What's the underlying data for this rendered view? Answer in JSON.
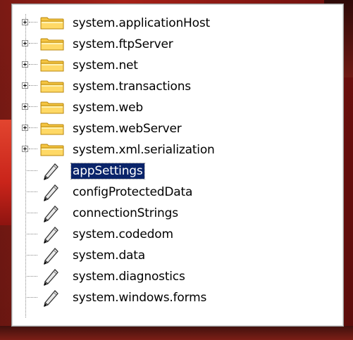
{
  "tree": {
    "folders": [
      {
        "label": "system.applicationHost",
        "icon": "folder-icon",
        "expander": "+"
      },
      {
        "label": "system.ftpServer",
        "icon": "folder-icon",
        "expander": "+"
      },
      {
        "label": "system.net",
        "icon": "folder-icon",
        "expander": "+"
      },
      {
        "label": "system.transactions",
        "icon": "folder-icon",
        "expander": "+"
      },
      {
        "label": "system.web",
        "icon": "folder-icon",
        "expander": "+"
      },
      {
        "label": "system.webServer",
        "icon": "folder-icon",
        "expander": "+"
      },
      {
        "label": "system.xml.serialization",
        "icon": "folder-icon",
        "expander": "+"
      }
    ],
    "leaves": [
      {
        "label": "appSettings",
        "icon": "pencil-icon",
        "selected": true
      },
      {
        "label": "configProtectedData",
        "icon": "pencil-icon",
        "selected": false
      },
      {
        "label": "connectionStrings",
        "icon": "pencil-icon",
        "selected": false
      },
      {
        "label": "system.codedom",
        "icon": "pencil-icon",
        "selected": false
      },
      {
        "label": "system.data",
        "icon": "pencil-icon",
        "selected": false
      },
      {
        "label": "system.diagnostics",
        "icon": "pencil-icon",
        "selected": false
      },
      {
        "label": "system.windows.forms",
        "icon": "pencil-icon",
        "selected": false
      }
    ]
  },
  "colors": {
    "selection": "#0a246a",
    "folder": "#f5c542",
    "backdrop": "#a62118"
  }
}
